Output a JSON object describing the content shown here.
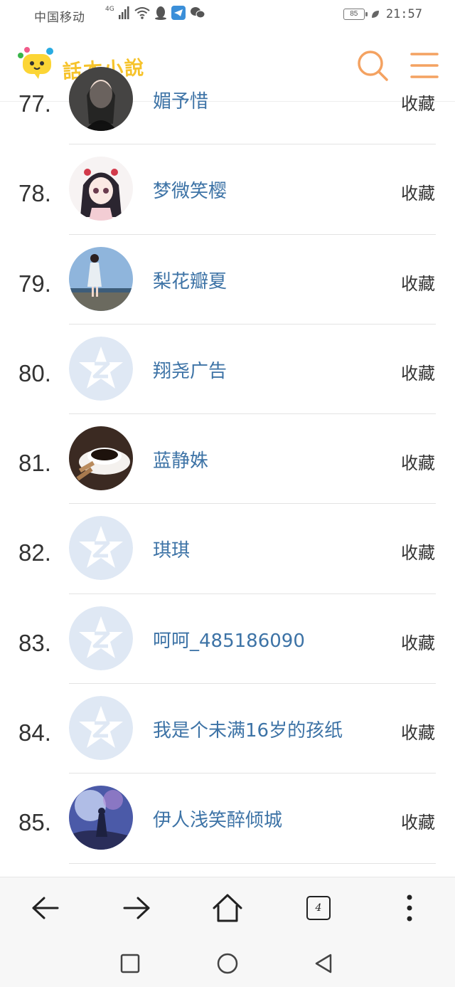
{
  "status_bar": {
    "carrier": "中国移动",
    "network": "4G",
    "battery": "85",
    "time": "21:57"
  },
  "header": {
    "brand": "話本小說",
    "accent_color": "#f4a261"
  },
  "list": [
    {
      "rank": "77.",
      "name": "媚予惜",
      "action": "收藏",
      "avatar": "photo-girl-dark"
    },
    {
      "rank": "78.",
      "name": "梦微笑樱",
      "action": "收藏",
      "avatar": "anime-girl"
    },
    {
      "rank": "79.",
      "name": "梨花瓣夏",
      "action": "收藏",
      "avatar": "photo-girl-sky"
    },
    {
      "rank": "80.",
      "name": "翔尧广告",
      "action": "收藏",
      "avatar": "default-qzone"
    },
    {
      "rank": "81.",
      "name": "蓝静姝",
      "action": "收藏",
      "avatar": "coffee-cup"
    },
    {
      "rank": "82.",
      "name": "琪琪",
      "action": "收藏",
      "avatar": "default-qzone"
    },
    {
      "rank": "83.",
      "name": "呵呵_485186090",
      "action": "收藏",
      "avatar": "default-qzone"
    },
    {
      "rank": "84.",
      "name": "我是个未满16岁的孩纸",
      "action": "收藏",
      "avatar": "default-qzone"
    },
    {
      "rank": "85.",
      "name": "伊人浅笑醉倾城",
      "action": "收藏",
      "avatar": "fantasy-scene"
    }
  ],
  "browser_bar": {
    "tab_count": "4"
  }
}
